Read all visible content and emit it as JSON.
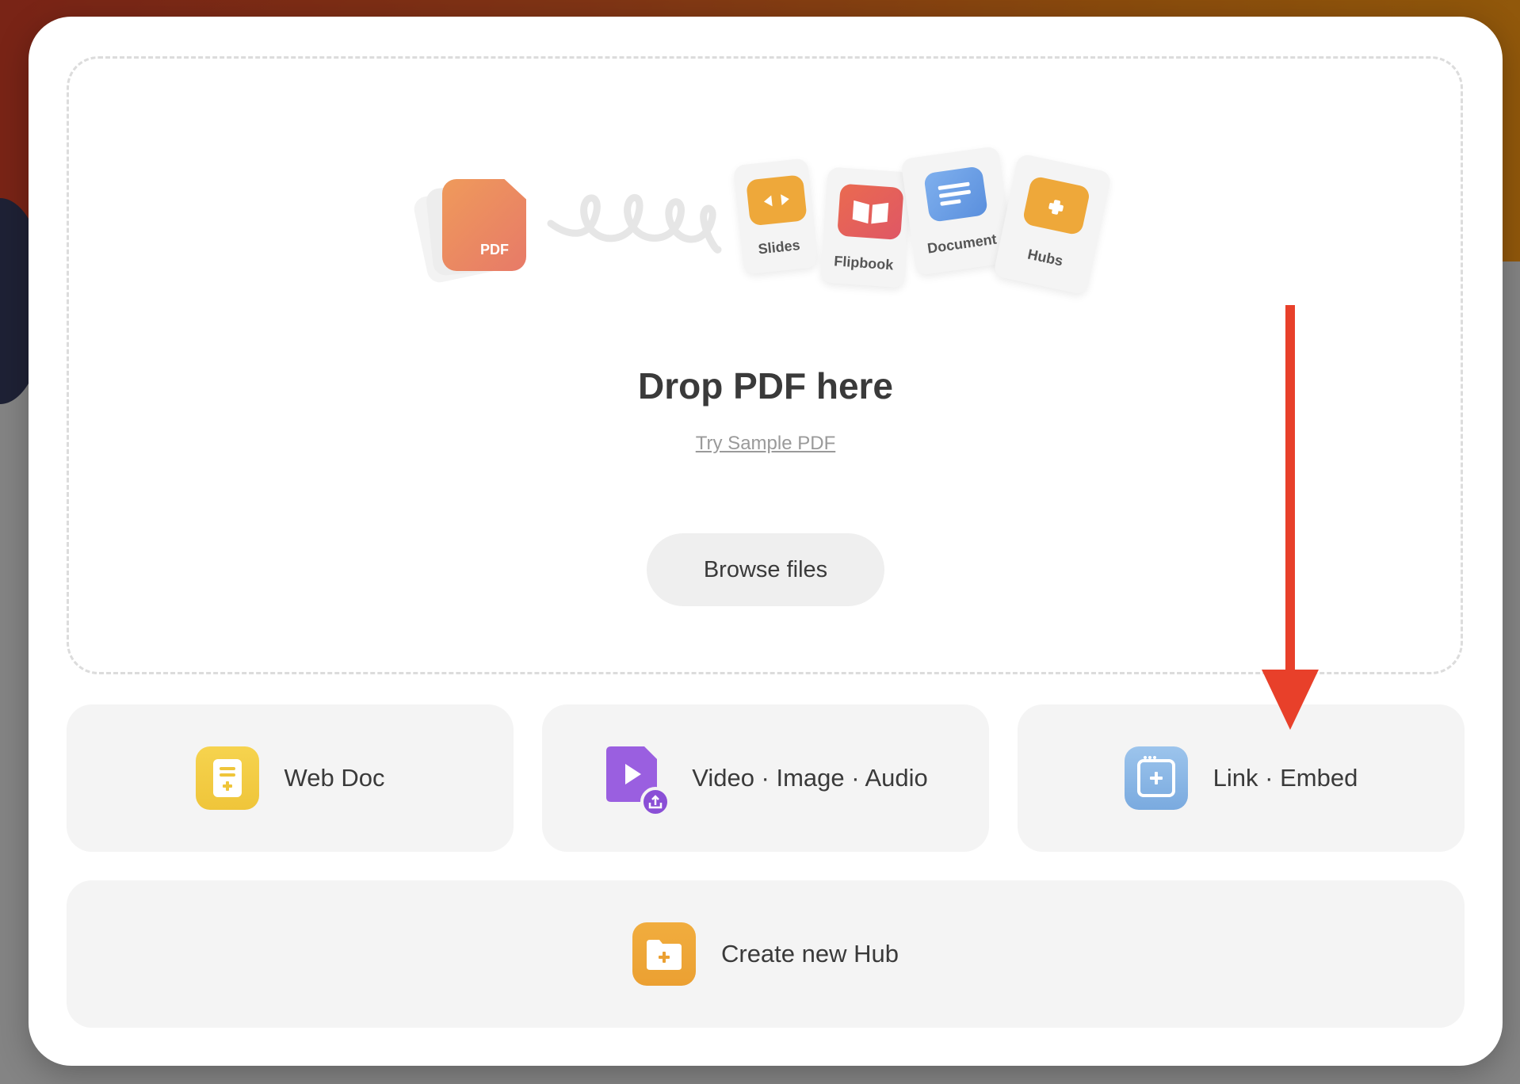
{
  "dropzone": {
    "title": "Drop PDF here",
    "sample_link": "Try Sample PDF",
    "browse_label": "Browse files",
    "pdf_label": "PDF",
    "formats": [
      "Slides",
      "Flipbook",
      "Document",
      "Hubs"
    ]
  },
  "options": {
    "web_doc": "Web Doc",
    "media": "Video · Image · Audio",
    "link_embed": "Link · Embed",
    "create_hub": "Create new Hub"
  },
  "colors": {
    "accent_orange": "#eba032",
    "pdf_gradient_start": "#ef9a5b",
    "pdf_gradient_end": "#e77a68",
    "web_doc_yellow": "#f3cc44",
    "media_purple": "#9a5fe0",
    "link_blue": "#86b4e4",
    "annotation_arrow": "#e8402a"
  },
  "icons": {
    "web_doc": "document-plus-icon",
    "media": "video-upload-icon",
    "link_embed": "browser-plus-icon",
    "create_hub": "folder-plus-icon",
    "slides": "slides-arrows-icon",
    "flipbook": "open-book-icon",
    "document": "text-lines-icon",
    "hubs": "folder-plus-icon"
  }
}
